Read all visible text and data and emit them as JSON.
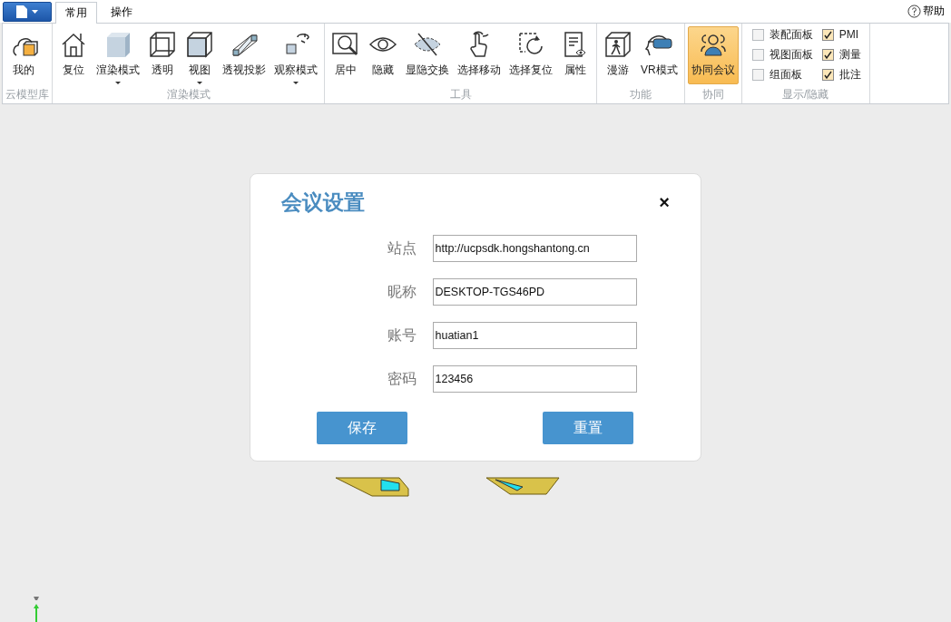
{
  "tabs": [
    {
      "label": "常用",
      "selected": true
    },
    {
      "label": "操作",
      "selected": false
    }
  ],
  "help": "帮助",
  "ribbon_groups": [
    {
      "kind": "buttons",
      "label": "云模型库",
      "items": [
        {
          "label": "我的",
          "dropdown": false,
          "selected": false
        }
      ]
    },
    {
      "kind": "buttons",
      "label": "渲染模式",
      "items": [
        {
          "label": "复位",
          "dropdown": false,
          "selected": false
        },
        {
          "label": "渲染模式",
          "dropdown": true,
          "selected": false
        },
        {
          "label": "透明",
          "dropdown": false,
          "selected": false
        },
        {
          "label": "视图",
          "dropdown": true,
          "selected": false
        },
        {
          "label": "透视投影",
          "dropdown": false,
          "selected": false
        },
        {
          "label": "观察模式",
          "dropdown": true,
          "selected": false
        }
      ]
    },
    {
      "kind": "buttons",
      "label": "工具",
      "items": [
        {
          "label": "居中",
          "dropdown": false,
          "selected": false
        },
        {
          "label": "隐藏",
          "dropdown": false,
          "selected": false
        },
        {
          "label": "显隐交换",
          "dropdown": false,
          "selected": false
        },
        {
          "label": "选择移动",
          "dropdown": false,
          "selected": false
        },
        {
          "label": "选择复位",
          "dropdown": false,
          "selected": false
        },
        {
          "label": "属性",
          "dropdown": false,
          "selected": false
        }
      ]
    },
    {
      "kind": "buttons",
      "label": "功能",
      "items": [
        {
          "label": "漫游",
          "dropdown": false,
          "selected": false
        },
        {
          "label": "VR模式",
          "dropdown": false,
          "selected": false
        }
      ]
    },
    {
      "kind": "buttons",
      "label": "协同",
      "items": [
        {
          "label": "协同会议",
          "dropdown": false,
          "selected": true
        }
      ]
    },
    {
      "kind": "checks",
      "label": "显示/隐藏",
      "items": [
        {
          "label": "装配面板",
          "checked": false
        },
        {
          "label": "视图面板",
          "checked": false
        },
        {
          "label": "组面板",
          "checked": false
        },
        {
          "label": "PMI",
          "checked": true
        },
        {
          "label": "测量",
          "checked": true
        },
        {
          "label": "批注",
          "checked": true
        }
      ]
    }
  ],
  "dialog": {
    "title": "会议设置",
    "close": "×",
    "fields": [
      {
        "label": "站点",
        "value": "http://ucpsdk.hongshantong.cn"
      },
      {
        "label": "昵称",
        "value": "DESKTOP-TGS46PD"
      },
      {
        "label": "账号",
        "value": "huatian1"
      },
      {
        "label": "密码",
        "value": "123456"
      }
    ],
    "buttons": [
      "保存",
      "重置"
    ]
  }
}
